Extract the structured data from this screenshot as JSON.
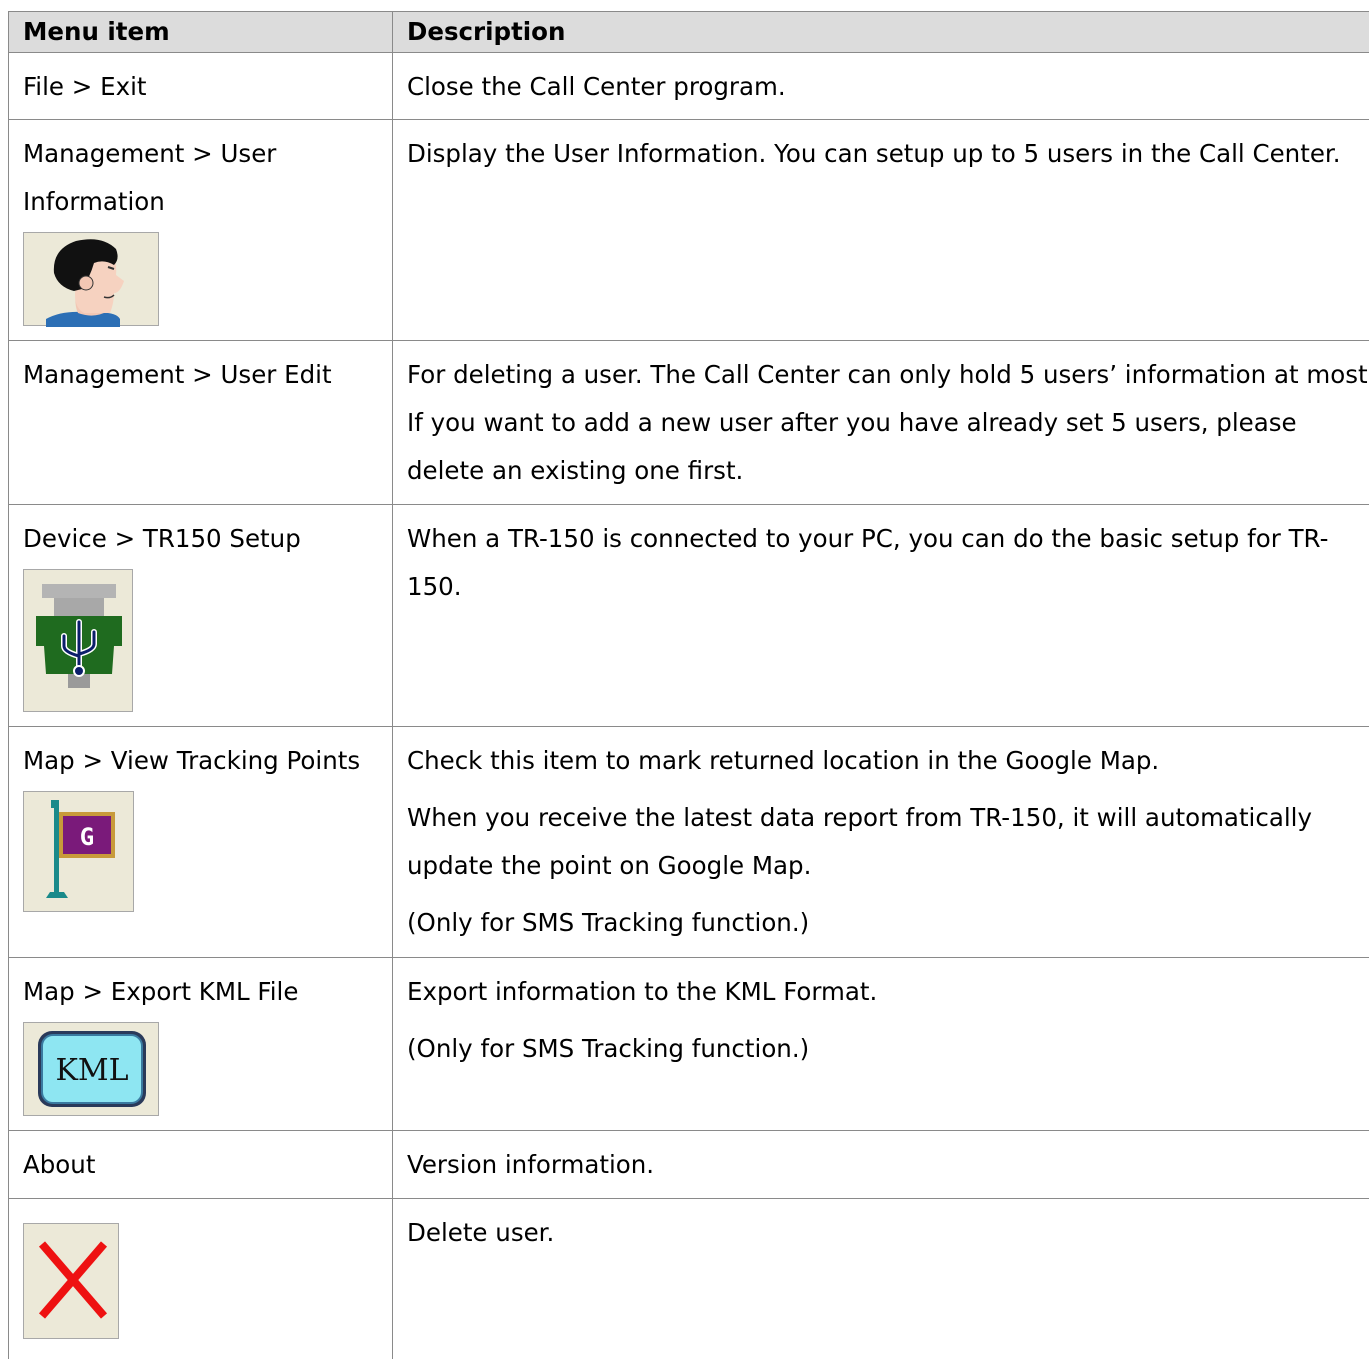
{
  "table": {
    "headers": [
      "Menu item",
      "Description"
    ],
    "rows": [
      {
        "menu": "File > Exit",
        "desc": [
          "Close the Call Center program."
        ]
      },
      {
        "menu": "Management > User Information",
        "icon": "user-head-icon",
        "desc": [
          "Display the User Information. You can setup up to 5 users in the Call Center."
        ]
      },
      {
        "menu": "Management > User Edit",
        "desc": [
          "For deleting a user. The Call Center can only hold 5 users’ information at most. If you want to add a new user after you have already set 5 users, please delete an existing one first."
        ]
      },
      {
        "menu": "Device > TR150 Setup",
        "icon": "usb-device-icon",
        "desc": [
          "When a TR-150 is connected to your PC, you can do the basic setup for TR-150."
        ]
      },
      {
        "menu": "Map > View Tracking Points",
        "icon": "google-map-flag-icon",
        "icon_text": "G",
        "desc": [
          "Check this item to mark returned location in the Google Map.",
          "When you receive the latest data report from TR-150, it will automatically update the point on Google Map.",
          "(Only for SMS Tracking function.)"
        ]
      },
      {
        "menu": "Map > Export KML File",
        "icon": "kml-export-icon",
        "icon_text": "KML",
        "desc": [
          "Export information to the KML Format.",
          "(Only for SMS Tracking function.)"
        ]
      },
      {
        "menu": "About",
        "desc": [
          "Version information."
        ]
      },
      {
        "menu": "",
        "icon": "delete-x-icon",
        "desc": [
          "Delete user."
        ]
      }
    ]
  }
}
